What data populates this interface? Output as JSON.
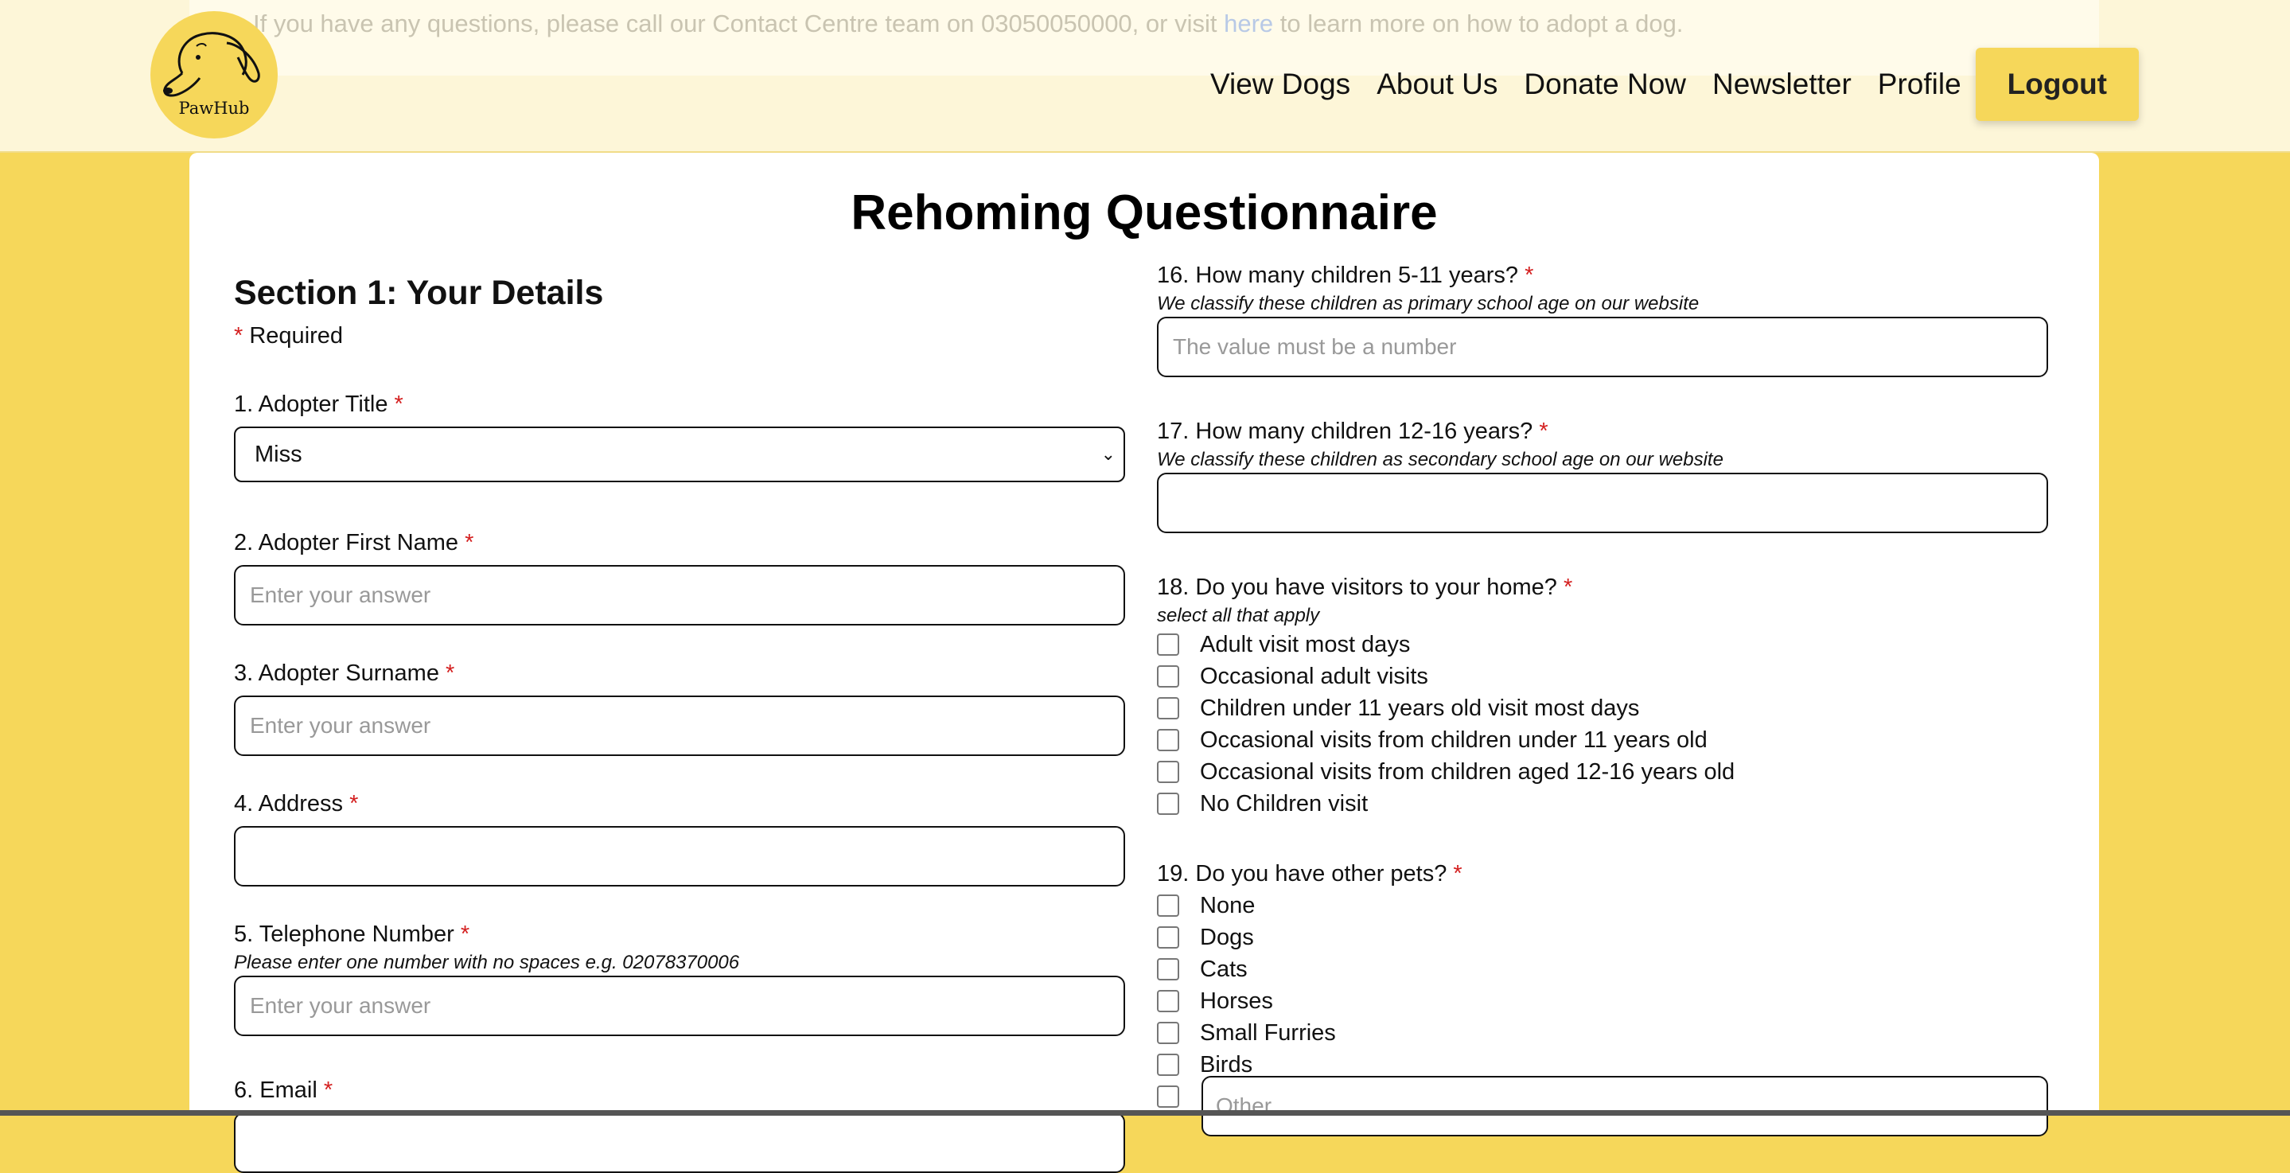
{
  "notice": {
    "before": "If you have any questions, please call our Contact Centre team on 03050050000, or visit ",
    "link": "here",
    "after": " to learn more on how to adopt a dog."
  },
  "logo": {
    "text": "PawHub"
  },
  "nav": {
    "view_dogs": "View Dogs",
    "about_us": "About Us",
    "donate_now": "Donate Now",
    "newsletter": "Newsletter",
    "profile": "Profile",
    "logout": "Logout"
  },
  "colors": {
    "accent": "#f6d75a",
    "header_bg": "#fdf6d8",
    "required": "#d42020"
  },
  "form": {
    "title": "Rehoming Questionnaire",
    "section_title": "Section 1: Your Details",
    "required_star": "*",
    "required_label": "Required",
    "q1": {
      "label": "1. Adopter Title",
      "value": "Miss"
    },
    "q2": {
      "label": "2. Adopter First Name",
      "placeholder": "Enter your answer"
    },
    "q3": {
      "label": "3. Adopter Surname",
      "placeholder": "Enter your answer"
    },
    "q4": {
      "label": "4. Address",
      "placeholder": ""
    },
    "q5": {
      "label": "5. Telephone Number",
      "hint": "Please enter one number with no spaces e.g. 02078370006",
      "placeholder": "Enter your answer"
    },
    "q6": {
      "label": "6. Email"
    },
    "q16": {
      "label": "16. How many children 5-11 years?",
      "hint": "We classify these children as primary school age on our website",
      "placeholder": "The value must be a number"
    },
    "q17": {
      "label": "17. How many children 12-16 years?",
      "hint": "We classify these children as secondary school age on our website",
      "placeholder": ""
    },
    "q18": {
      "label": "18. Do you have visitors to your home?",
      "hint": "select all that apply",
      "options": [
        "Adult visit most days",
        "Occasional adult visits",
        "Children under 11 years old visit most days",
        "Occasional visits from children under 11 years old",
        "Occasional visits from children aged 12-16 years old",
        "No Children visit"
      ]
    },
    "q19": {
      "label": "19. Do you have other pets?",
      "options": [
        "None",
        "Dogs",
        "Cats",
        "Horses",
        "Small Furries",
        "Birds"
      ],
      "other_placeholder": "Other"
    }
  }
}
